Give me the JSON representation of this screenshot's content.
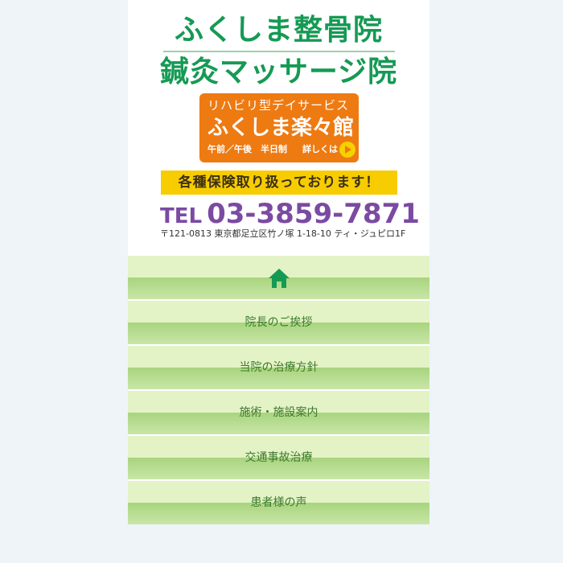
{
  "header": {
    "title_line1": "ふくしま整骨院",
    "title_line2": "鍼灸マッサージ院",
    "day_service": {
      "sub": "リハビリ型デイサービス",
      "name": "ふくしま楽々館",
      "schedule": "午前／午後　半日制",
      "more": "詳しくは"
    },
    "insurance": "各種保険取り扱っております！",
    "tel_label": "TEL",
    "tel_number": "03-3859-7871",
    "address": "〒121-0813  東京都足立区竹ノ塚 1-18-10  ティ・ジュピロ1F"
  },
  "nav": {
    "items": [
      {
        "label": "院長のご挨拶"
      },
      {
        "label": "当院の治療方針"
      },
      {
        "label": "施術・施設案内"
      },
      {
        "label": "交通事故治療"
      },
      {
        "label": "患者様の声"
      }
    ]
  },
  "colors": {
    "title_green": "#159a54",
    "day_service_orange": "#ee7a12",
    "insurance_yellow": "#f7cc00",
    "tel_purple": "#7b4aa2",
    "nav_green": "#a8d47e"
  },
  "icons": {
    "home": "home-icon",
    "arrow": "play-arrow-icon"
  }
}
